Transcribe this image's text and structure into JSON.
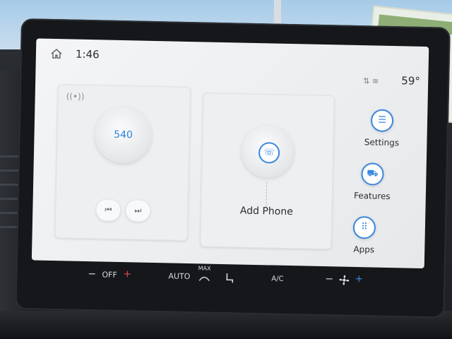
{
  "status": {
    "time": "1:46",
    "temperature": "59°",
    "home_icon": "home-icon",
    "signal_icons": "⇅ ≋"
  },
  "radio": {
    "station": "540",
    "prev_label": "⏮",
    "next_label": "⏭",
    "wave_icon": "((•))"
  },
  "phone": {
    "label": "Add Phone",
    "icon": "☏"
  },
  "side_menu": {
    "settings": {
      "label": "Settings",
      "icon": "☰"
    },
    "features": {
      "label": "Features",
      "icon": "⛟"
    },
    "apps": {
      "label": "Apps",
      "icon": "⠿"
    }
  },
  "climate": {
    "minus": "−",
    "off": "OFF",
    "plus": "+",
    "auto": "AUTO",
    "max": "MAX",
    "ac": "A/C",
    "fan_minus": "−",
    "fan_plus": "+"
  },
  "colors": {
    "accent": "#3b87dd",
    "screen_bg": "#eeeff1",
    "plus_red": "#e04a4a"
  }
}
